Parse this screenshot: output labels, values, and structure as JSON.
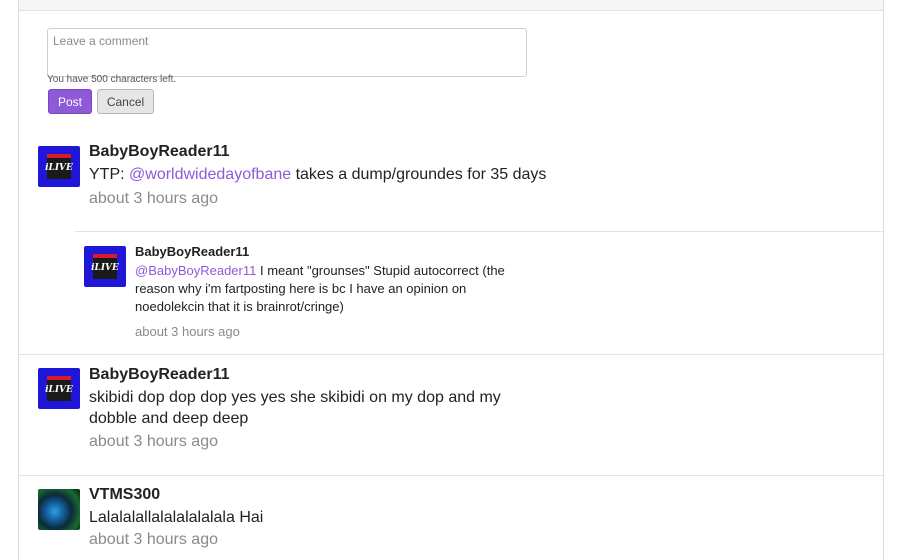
{
  "form": {
    "placeholder": "Leave a comment",
    "chars_left": "You have 500 characters left.",
    "post_label": "Post",
    "cancel_label": "Cancel"
  },
  "colors": {
    "accent": "#8e5ad8",
    "avatar_blue": "#2016d8"
  },
  "comments": [
    {
      "avatar_icon": "ilive-avatar-icon",
      "author": "BabyBoyReader11",
      "text_prefix": "YTP: ",
      "mention": "@worldwidedayofbane",
      "text": " takes a dump/groundes for 35 days",
      "time": "about 3 hours ago",
      "replies": [
        {
          "avatar_icon": "ilive-avatar-icon",
          "author": "BabyBoyReader11",
          "mention": "@BabyBoyReader11",
          "text": " I meant \"grounses\" Stupid autocorrect (the reason why i'm fartposting here is bc I have an opinion on noedolekcin that it is brainrot/cringe)",
          "time": "about 3 hours ago"
        }
      ]
    },
    {
      "avatar_icon": "ilive-avatar-icon",
      "author": "BabyBoyReader11",
      "text": "skibidi dop dop dop yes yes she skibidi on my dop and my dobble and deep deep",
      "time": "about 3 hours ago"
    },
    {
      "avatar_icon": "earth-avatar-icon",
      "author": "VTMS300",
      "text": "Lalalalallalalalalalala Hai",
      "time": "about 3 hours ago"
    }
  ]
}
